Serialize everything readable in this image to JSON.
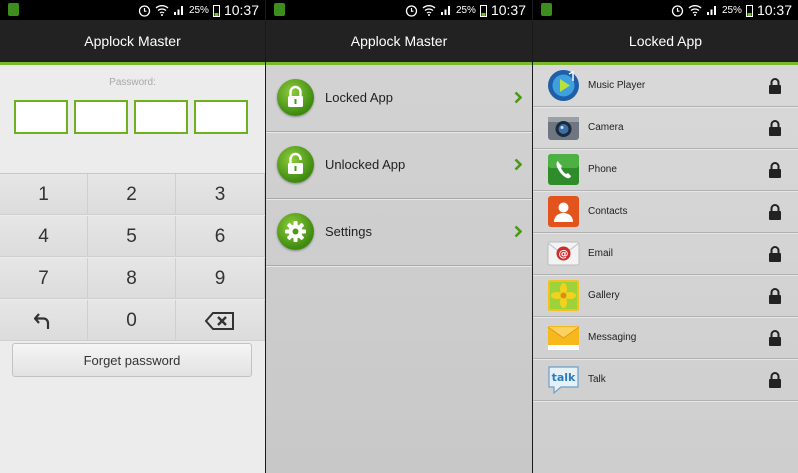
{
  "status_bar": {
    "battery": "25%",
    "time": "10:37"
  },
  "pin_screen": {
    "title": "Applock Master",
    "password_label": "Password:",
    "keys": [
      "1",
      "2",
      "3",
      "4",
      "5",
      "6",
      "7",
      "8",
      "9",
      "0"
    ],
    "forget_button": "Forget password"
  },
  "main_menu": {
    "title": "Applock Master",
    "items": [
      {
        "label": "Locked App",
        "icon": "lock-closed-icon"
      },
      {
        "label": "Unlocked App",
        "icon": "lock-open-icon"
      },
      {
        "label": "Settings",
        "icon": "gear-icon"
      }
    ]
  },
  "locked_apps": {
    "title": "Locked App",
    "apps": [
      {
        "label": "Music Player",
        "icon": "music-player-icon"
      },
      {
        "label": "Camera",
        "icon": "camera-icon"
      },
      {
        "label": "Phone",
        "icon": "phone-icon"
      },
      {
        "label": "Contacts",
        "icon": "contacts-icon"
      },
      {
        "label": "Email",
        "icon": "email-icon"
      },
      {
        "label": "Gallery",
        "icon": "gallery-icon"
      },
      {
        "label": "Messaging",
        "icon": "messaging-icon"
      },
      {
        "label": "Talk",
        "icon": "talk-icon"
      }
    ]
  },
  "colors": {
    "accent": "#7ab82c",
    "title_bar": "#222222",
    "green_button": "#4a9a16"
  }
}
